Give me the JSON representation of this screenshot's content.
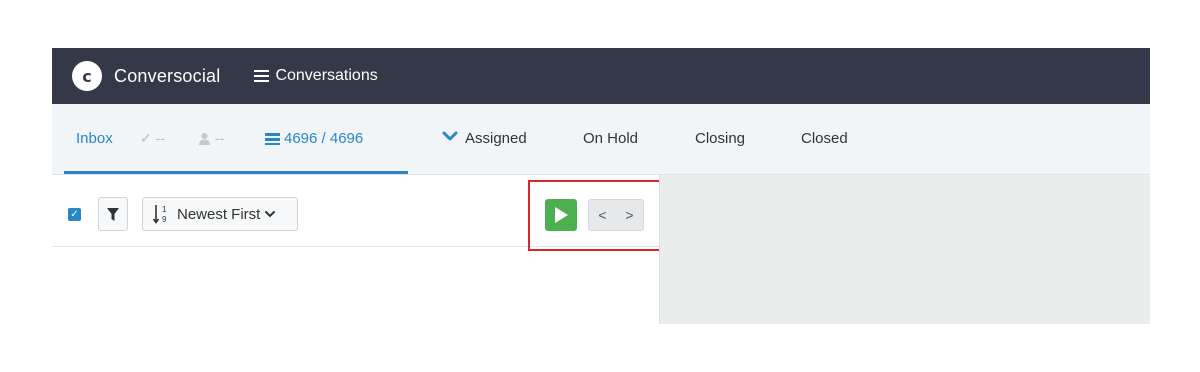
{
  "app": {
    "logo_letter": "c",
    "brand": "Conversocial",
    "nav_conversations": "Conversations"
  },
  "tabs": {
    "inbox": "Inbox",
    "checked_stat": "✓ --",
    "user_stat": "--",
    "count": "4696 / 4696",
    "assigned": "Assigned",
    "on_hold": "On Hold",
    "closing": "Closing",
    "closed": "Closed"
  },
  "toolbar": {
    "select_all_checked": true,
    "sort_label": "Newest First",
    "sort_icon_text": "1 9",
    "pager_prev": "<",
    "pager_next": ">"
  },
  "colors": {
    "topbar": "#343848",
    "accent": "#2a86c4",
    "play": "#4caf50",
    "highlight": "#d9262c"
  },
  "icons": [
    "logo-c",
    "list-icon",
    "check-icon",
    "user-icon",
    "chevron-down-icon",
    "filter-icon",
    "sort-numeric-icon",
    "play-icon",
    "prev-icon",
    "next-icon"
  ]
}
